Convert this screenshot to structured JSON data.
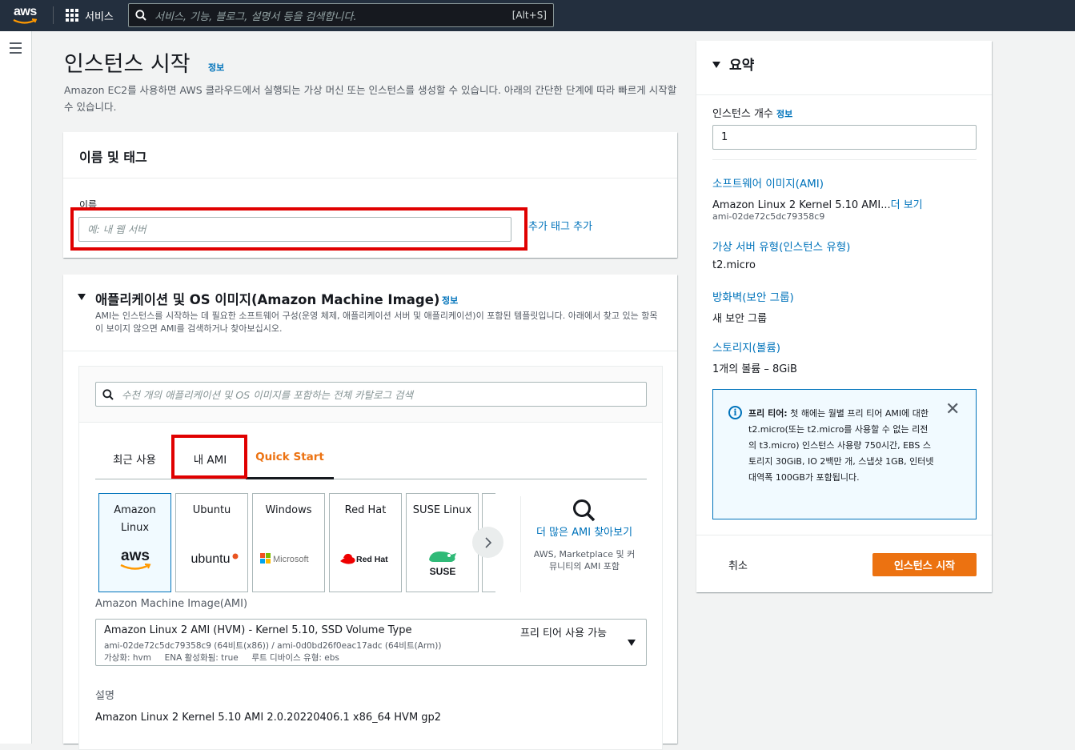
{
  "topbar": {
    "logo_text": "aws",
    "services_label": "서비스",
    "search_placeholder": "서비스, 기능, 블로그, 설명서 등을 검색합니다.",
    "search_shortcut": "[Alt+S]"
  },
  "page": {
    "title": "인스턴스 시작",
    "info_link": "정보",
    "description": "Amazon EC2를 사용하면 AWS 클라우드에서 실행되는 가상 머신 또는 인스턴스를 생성할 수 있습니다. 아래의 간단한 단계에 따라 빠르게 시작할 수 있습니다."
  },
  "name_tags": {
    "title": "이름 및 태그",
    "name_label": "이름",
    "name_placeholder": "예: 내 웹 서버",
    "add_tags_link": "추가 태그 추가"
  },
  "ami_section": {
    "title": "애플리케이션 및 OS 이미지(Amazon Machine Image)",
    "info_link": "정보",
    "description": "AMI는 인스턴스를 시작하는 데 필요한 소프트웨어 구성(운영 체제, 애플리케이션 서버 및 애플리케이션)이 포함된 템플릿입니다. 아래에서 찾고 있는 항목이 보이지 않으면 AMI를 검색하거나 찾아보십시오.",
    "search_placeholder": "수천 개의 애플리케이션 및 OS 이미지를 포함하는 전체 카탈로그 검색",
    "tabs": [
      {
        "label": "최근 사용"
      },
      {
        "label": "내 AMI"
      },
      {
        "label": "Quick Start"
      }
    ],
    "tiles": [
      {
        "name": "Amazon Linux",
        "logo": "aws"
      },
      {
        "name": "Ubuntu",
        "logo": "ubuntu"
      },
      {
        "name": "Windows",
        "logo": "Microsoft"
      },
      {
        "name": "Red Hat",
        "logo": "Red Hat"
      },
      {
        "name": "SUSE Linux",
        "logo": "SUSE"
      }
    ],
    "more_title": "더 많은 AMI 찾아보기",
    "more_sub": "AWS, Marketplace 및 커뮤니티의 AMI 포함",
    "ami_label": "Amazon Machine Image(AMI)",
    "ami_selected": {
      "name": "Amazon Linux 2 AMI (HVM) - Kernel 5.10, SSD Volume Type",
      "ids": "ami-02de72c5dc79358c9 (64비트(x86)) / ami-0d0bd26f0eac17adc (64비트(Arm))",
      "meta": "가상화: hvm     ENA 활성화됨: true     루트 디바이스 유형: ebs",
      "free_tier": "프리 티어 사용 가능"
    },
    "desc_label": "설명",
    "desc_value": "Amazon Linux 2 Kernel 5.10 AMI 2.0.20220406.1 x86_64 HVM gp2"
  },
  "summary": {
    "title": "요약",
    "count_label": "인스턴스 개수",
    "count_info": "정보",
    "count_value": "1",
    "image_link": "소프트웨어 이미지(AMI)",
    "image_value": "Amazon Linux 2 Kernel 5.10 AMI...",
    "image_more": "더 보기",
    "image_id": "ami-02de72c5dc79358c9",
    "type_link": "가상 서버 유형(인스턴스 유형)",
    "type_value": "t2.micro",
    "fw_link": "방화벽(보안 그룹)",
    "fw_value": "새 보안 그룹",
    "storage_link": "스토리지(볼륨)",
    "storage_value": "1개의 볼륨 – 8GiB",
    "alert_bold": "프리 티어:",
    "alert_text": "첫 해에는 월별 프리 티어 AMI에 대한 t2.micro(또는 t2.micro를 사용할 수 없는 리전의 t3.micro) 인스턴스 사용량 750시간, EBS 스토리지 30GiB, IO 2백만 개, 스냅샷 1GB, 인터넷 대역폭 100GB가 포함됩니다.",
    "cancel_label": "취소",
    "launch_label": "인스턴스 시작"
  },
  "colors": {
    "topbar": "#232f3e",
    "link": "#0073bb",
    "accent": "#ec7211",
    "highlight": "#e00000"
  }
}
